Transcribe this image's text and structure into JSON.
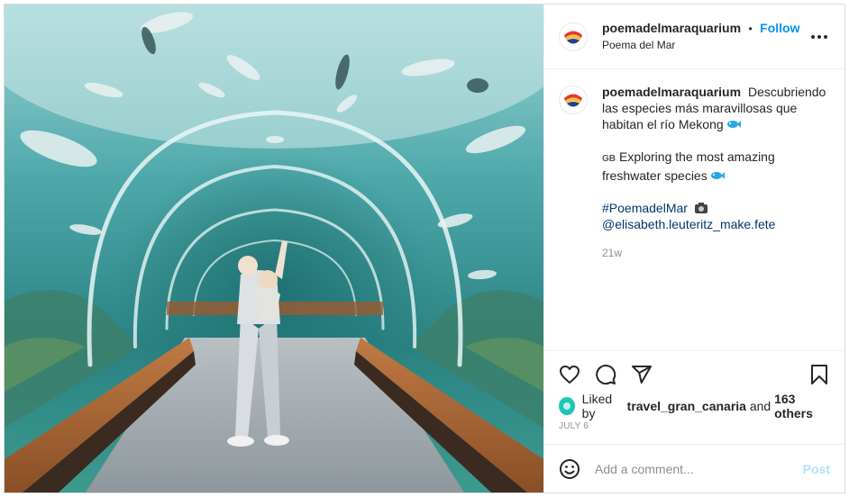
{
  "header": {
    "username": "poemadelmaraquarium",
    "separator": "•",
    "follow_label": "Follow",
    "location": "Poema del Mar",
    "more_icon": "more-horizontal-icon"
  },
  "caption": {
    "username": "poemadelmaraquarium",
    "line1": "Descubriendo",
    "line2": "las especies más maravillosas que",
    "line3": "habitan el río Mekong",
    "flag": "GB",
    "en_line1": "Exploring the most amazing",
    "en_line2": "freshwater species",
    "hashtag": "#PoemadelMar",
    "mention": "@elisabeth.leuteritz_make.fete",
    "time": "21w"
  },
  "actions": {
    "like_icon": "heart-icon",
    "comment_icon": "comment-icon",
    "share_icon": "share-icon",
    "save_icon": "bookmark-icon"
  },
  "likes": {
    "prefix": "Liked by",
    "user": "travel_gran_canaria",
    "and": "and",
    "others": "163 others"
  },
  "date": "JULY 6",
  "comment": {
    "placeholder": "Add a comment...",
    "post_label": "Post"
  },
  "colors": {
    "link": "#0095f6",
    "post_disabled": "#b2dffc",
    "secondary_text": "#8e8e8e",
    "water": "#2e8f93"
  }
}
